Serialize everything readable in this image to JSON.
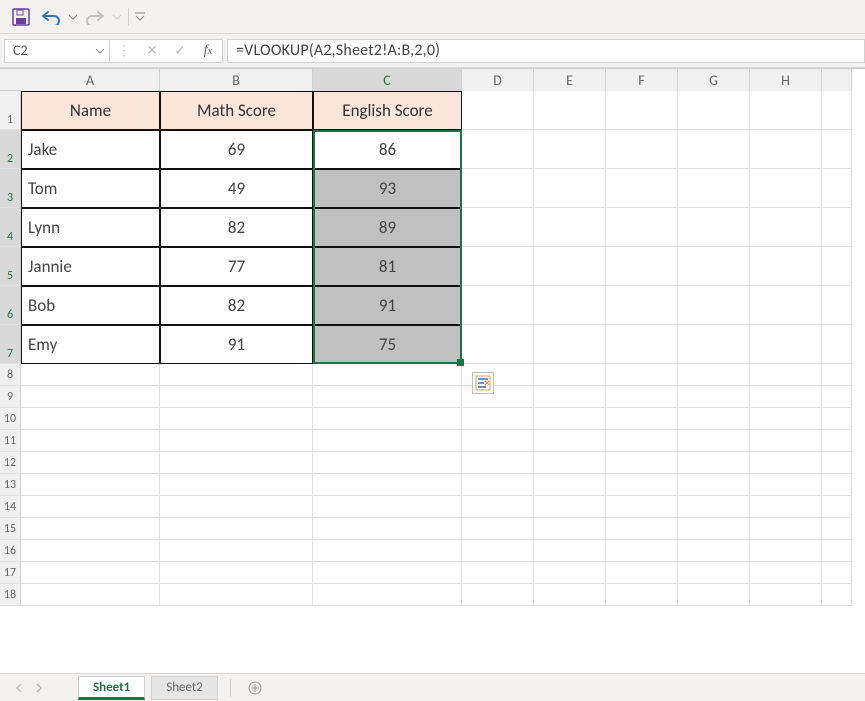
{
  "qat": {
    "save": "save",
    "undo": "undo",
    "redo": "redo"
  },
  "namebox": "C2",
  "formula": "=VLOOKUP(A2,Sheet2!A:B,2,0)",
  "columns": [
    "A",
    "B",
    "C",
    "D",
    "E",
    "F",
    "G",
    "H"
  ],
  "header_row_label": "1",
  "row_labels": [
    "2",
    "3",
    "4",
    "5",
    "6",
    "7",
    "8",
    "9",
    "10",
    "11",
    "12",
    "13",
    "14",
    "15",
    "16",
    "17",
    "18"
  ],
  "headers": {
    "A": "Name",
    "B": "Math Score",
    "C": "English Score"
  },
  "rows": [
    {
      "name": "Jake",
      "math": "69",
      "eng": "86"
    },
    {
      "name": "Tom",
      "math": "49",
      "eng": "93"
    },
    {
      "name": "Lynn",
      "math": "82",
      "eng": "89"
    },
    {
      "name": "Jannie",
      "math": "77",
      "eng": "81"
    },
    {
      "name": "Bob",
      "math": "82",
      "eng": "91"
    },
    {
      "name": "Emy",
      "math": "91",
      "eng": "75"
    }
  ],
  "sheets": {
    "active": "Sheet1",
    "other": "Sheet2"
  },
  "colors": {
    "accent": "#217346",
    "headerfill": "#fce6db"
  }
}
